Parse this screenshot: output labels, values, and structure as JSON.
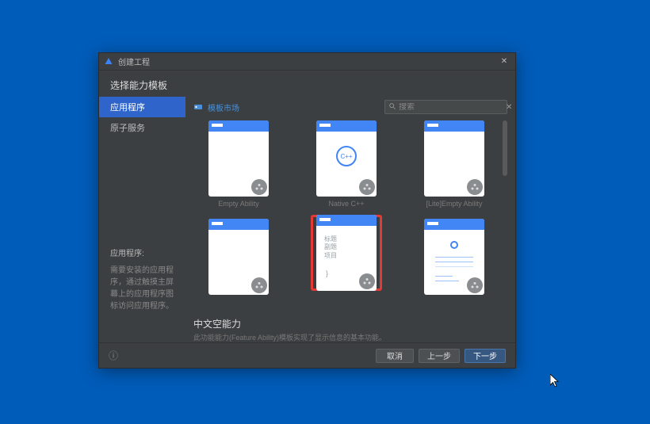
{
  "window": {
    "title": "创建工程"
  },
  "section_title": "选择能力模板",
  "sidebar": {
    "items": [
      {
        "label": "应用程序",
        "active": true
      },
      {
        "label": "原子服务",
        "active": false
      }
    ],
    "footer": {
      "heading": "应用程序:",
      "desc": "需要安装的应用程序，通过触摸主屏幕上的应用程序图标访问应用程序。"
    }
  },
  "content": {
    "market_link": "模板市场",
    "search": {
      "placeholder": "搜索",
      "value": ""
    },
    "templates": [
      {
        "id": "empty",
        "label": "Empty Ability",
        "kind": "empty"
      },
      {
        "id": "native",
        "label": "Native C++",
        "kind": "native-cpp"
      },
      {
        "id": "lite",
        "label": "[Lite]Empty Ability",
        "kind": "empty"
      },
      {
        "id": "blank1",
        "label": "",
        "kind": "empty"
      },
      {
        "id": "chinese",
        "label": "",
        "kind": "chinese",
        "selected": true
      },
      {
        "id": "about",
        "label": "",
        "kind": "about"
      }
    ],
    "selected_detail": {
      "title": "中文空能力",
      "subtitle": "此功能能力(Feature Ability)模板实现了显示信息的基本功能。"
    }
  },
  "footer": {
    "cancel": "取消",
    "prev": "上一步",
    "next": "下一步"
  }
}
